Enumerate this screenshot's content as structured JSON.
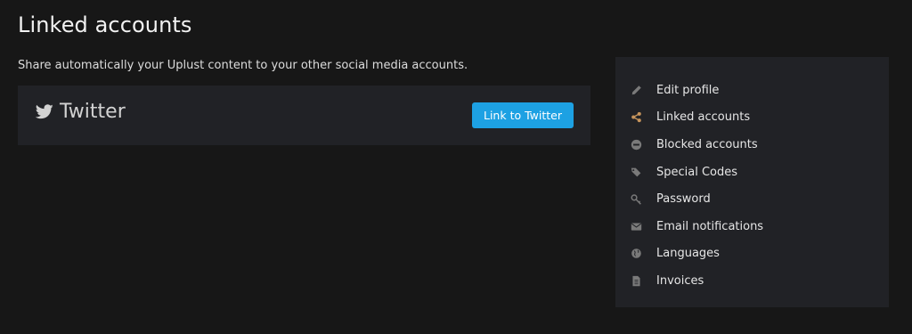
{
  "page": {
    "title": "Linked accounts",
    "description": "Share automatically your Uplust content to your other social media accounts."
  },
  "accounts": [
    {
      "name": "Twitter",
      "icon": "twitter-icon",
      "button_label": "Link to Twitter",
      "button_color": "#1da1e3"
    }
  ],
  "sidebar": {
    "items": [
      {
        "label": "Edit profile",
        "icon": "pencil-icon",
        "active": false
      },
      {
        "label": "Linked accounts",
        "icon": "share-icon",
        "active": true
      },
      {
        "label": "Blocked accounts",
        "icon": "block-icon",
        "active": false
      },
      {
        "label": "Special Codes",
        "icon": "tags-icon",
        "active": false
      },
      {
        "label": "Password",
        "icon": "key-icon",
        "active": false
      },
      {
        "label": "Email notifications",
        "icon": "envelope-icon",
        "active": false
      },
      {
        "label": "Languages",
        "icon": "globe-icon",
        "active": false
      },
      {
        "label": "Invoices",
        "icon": "document-icon",
        "active": false
      }
    ]
  },
  "colors": {
    "background": "#171717",
    "panel": "#212226",
    "accent_active_icon": "#c8955c",
    "inactive_icon": "#7a7a7a",
    "twitter_blue": "#1da1e3"
  }
}
